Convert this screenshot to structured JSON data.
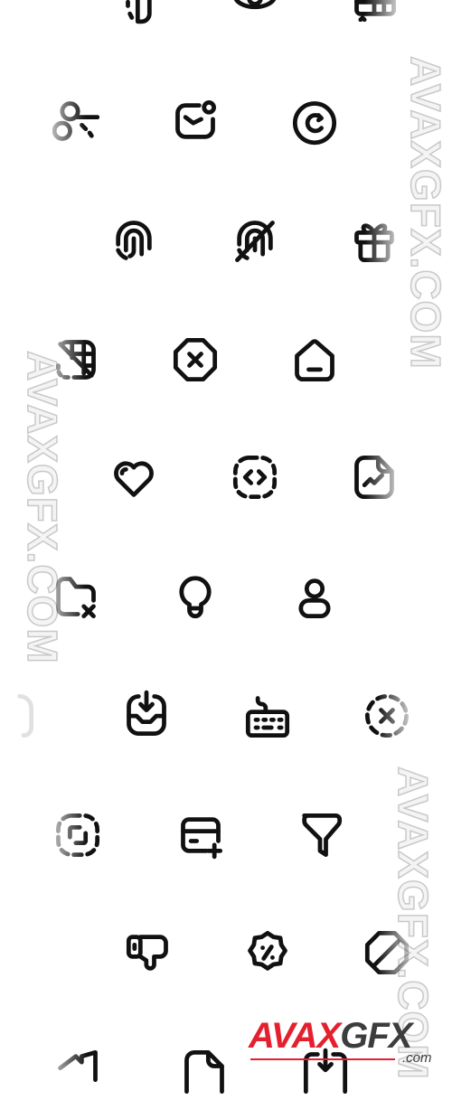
{
  "page": {
    "background": "#ffffff",
    "icon_color": "#111111"
  },
  "icons": [
    {
      "row": 0,
      "col": 0,
      "name": "dashed-file-icon"
    },
    {
      "row": 0,
      "col": 1,
      "name": "eye-icon"
    },
    {
      "row": 0,
      "col": 2,
      "name": "table-grid-icon"
    },
    {
      "row": 1,
      "col": 0,
      "name": "scissors-cut-icon"
    },
    {
      "row": 1,
      "col": 1,
      "name": "mail-notification-icon"
    },
    {
      "row": 1,
      "col": 2,
      "name": "refresh-circle-icon"
    },
    {
      "row": 2,
      "col": 0,
      "name": "fingerprint-icon"
    },
    {
      "row": 2,
      "col": 1,
      "name": "fingerprint-off-icon"
    },
    {
      "row": 2,
      "col": 2,
      "name": "gift-icon"
    },
    {
      "row": 3,
      "col": 0,
      "name": "grid-half-icon"
    },
    {
      "row": 3,
      "col": 1,
      "name": "octagon-close-icon"
    },
    {
      "row": 3,
      "col": 2,
      "name": "home-icon"
    },
    {
      "row": 4,
      "col": 0,
      "name": "heart-icon"
    },
    {
      "row": 4,
      "col": 1,
      "name": "dashed-code-icon"
    },
    {
      "row": 4,
      "col": 2,
      "name": "file-chart-icon"
    },
    {
      "row": 5,
      "col": 0,
      "name": "folder-close-icon"
    },
    {
      "row": 5,
      "col": 1,
      "name": "lightbulb-icon"
    },
    {
      "row": 5,
      "col": 2,
      "name": "user-icon"
    },
    {
      "row": 6,
      "col": 0,
      "name": "inbox-download-icon"
    },
    {
      "row": 6,
      "col": 1,
      "name": "keyboard-icon"
    },
    {
      "row": 6,
      "col": 2,
      "name": "dashed-circle-close-icon"
    },
    {
      "row": 7,
      "col": 0,
      "name": "dashed-scan-icon"
    },
    {
      "row": 7,
      "col": 1,
      "name": "credit-card-add-icon"
    },
    {
      "row": 7,
      "col": 2,
      "name": "filter-icon"
    },
    {
      "row": 8,
      "col": 0,
      "name": "thumbs-down-icon"
    },
    {
      "row": 8,
      "col": 1,
      "name": "discount-badge-icon"
    },
    {
      "row": 8,
      "col": 2,
      "name": "octagon-slash-icon"
    },
    {
      "row": 9,
      "col": 0,
      "name": "video-icon"
    },
    {
      "row": 9,
      "col": 1,
      "name": "file-icon"
    },
    {
      "row": 9,
      "col": 2,
      "name": "download-box-icon"
    }
  ],
  "watermarks": [
    {
      "text": "AVAXGFX.COM"
    },
    {
      "text": "AVAXGFX.COM"
    },
    {
      "text": "AVAXGFX.COM"
    }
  ],
  "logo": {
    "part_a": "AVAX",
    "part_b": "GFX",
    "suffix": ".com",
    "accent": "#e5202e",
    "dark": "#3d3d3d"
  }
}
